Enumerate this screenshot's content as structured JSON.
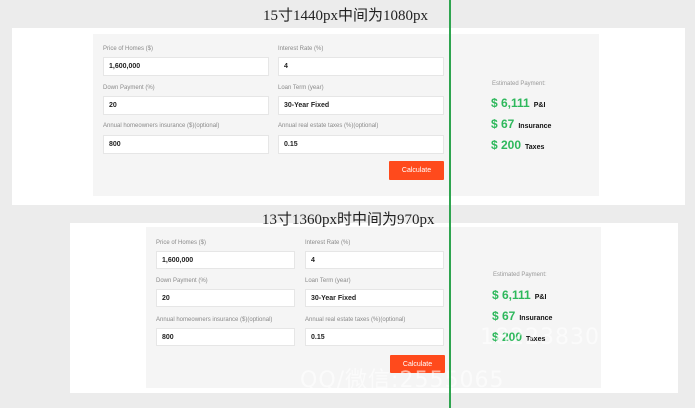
{
  "colors": {
    "accent": "#ff4a1c",
    "result": "#2eb85c",
    "divider": "#2ea44f"
  },
  "top": {
    "caption": "15寸1440px中间为1080px",
    "fields": {
      "price_label": "Price of Homes ($)",
      "price_value": "1,600,000",
      "rate_label": "Interest Rate (%)",
      "rate_value": "4",
      "down_label": "Down Payment (%)",
      "down_value": "20",
      "term_label": "Loan Term (year)",
      "term_value": "30-Year Fixed",
      "insurance_label": "Annual homeowners insurance ($)(optional)",
      "insurance_value": "800",
      "tax_label": "Annual real estate taxes (%)(optional)",
      "tax_value": "0.15"
    },
    "calculate_label": "Calculate",
    "estimated_label": "Estimated Payment:",
    "results": {
      "pi_amount": "$ 6,111",
      "pi_label": "P&I",
      "ins_amount": "$ 67",
      "ins_label": "Insurance",
      "tax_amount": "$ 200",
      "tax_label": "Taxes"
    }
  },
  "bottom": {
    "caption": "13寸1360px时中间为970px",
    "fields": {
      "price_label": "Price of Homes ($)",
      "price_value": "1,600,000",
      "rate_label": "Interest Rate (%)",
      "rate_value": "4",
      "down_label": "Down Payment (%)",
      "down_value": "20",
      "term_label": "Loan Term (year)",
      "term_value": "30-Year Fixed",
      "insurance_label": "Annual homeowners insurance ($)(optional)",
      "insurance_value": "800",
      "tax_label": "Annual real estate taxes (%)(optional)",
      "tax_value": "0.15"
    },
    "calculate_label": "Calculate",
    "estimated_label": "Estimated Payment:",
    "results": {
      "pi_amount": "$ 6,111",
      "pi_label": "P&I",
      "ins_amount": "$ 67",
      "ins_label": "Insurance",
      "tax_amount": "$ 200",
      "tax_label": "Taxes"
    }
  },
  "watermark": {
    "line1": "18223830",
    "line2": "QQ/微信:2555065"
  }
}
